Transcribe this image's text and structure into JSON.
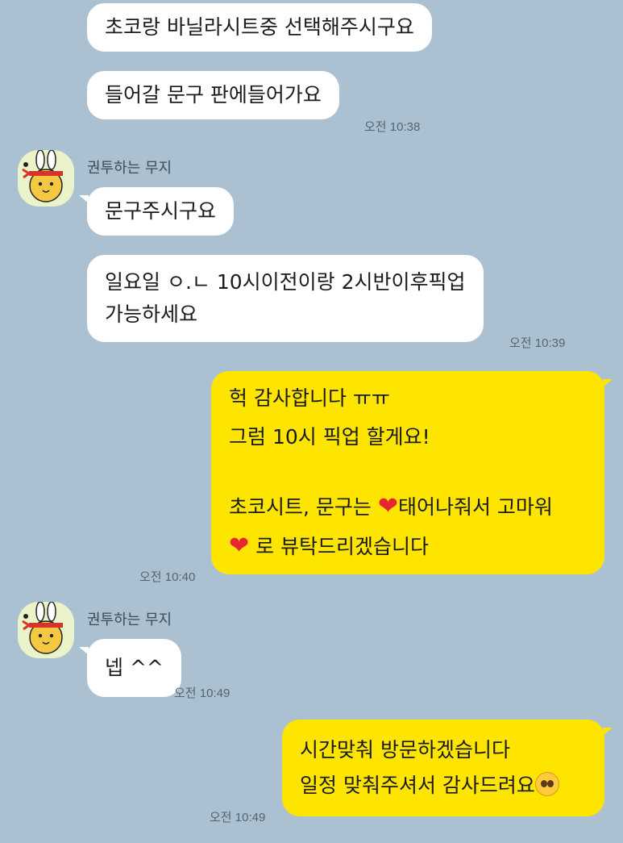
{
  "chat": {
    "messages": [
      {
        "text": "초코랑 바닐라시트중 선택해주시구요"
      },
      {
        "text": "들어갈 문구 판에들어가요",
        "time": "오전 10:38"
      },
      {
        "text": "문구주시구요"
      },
      {
        "line1": "일요일 ㅇ.ㄴ 10시이전이랑 2시반이후픽업",
        "line2": "가능하세요",
        "time": "오전 10:39"
      },
      {
        "line1": "헉 감사합니다 ㅠㅠ",
        "line2": "그럼 10시 픽업 할게요!",
        "line3a": "초코시트, 문구는 ",
        "line3b": "태어나줘서 고마워",
        "line4": " 로 뷰탁드리겠습니다",
        "time": "오전 10:40"
      },
      {
        "text": "넵 ^^",
        "time": "오전 10:49"
      },
      {
        "line1": "시간맞춰 방문하겠습니다",
        "line2": "일정 맞춰주셔서 감사드려요",
        "time": "오전 10:49"
      }
    ],
    "sender_name": "권투하는 무지",
    "heart_glyph": "❤",
    "colors": {
      "background": "#abc1d1",
      "outgoing": "#fee500",
      "incoming": "#ffffff"
    }
  }
}
